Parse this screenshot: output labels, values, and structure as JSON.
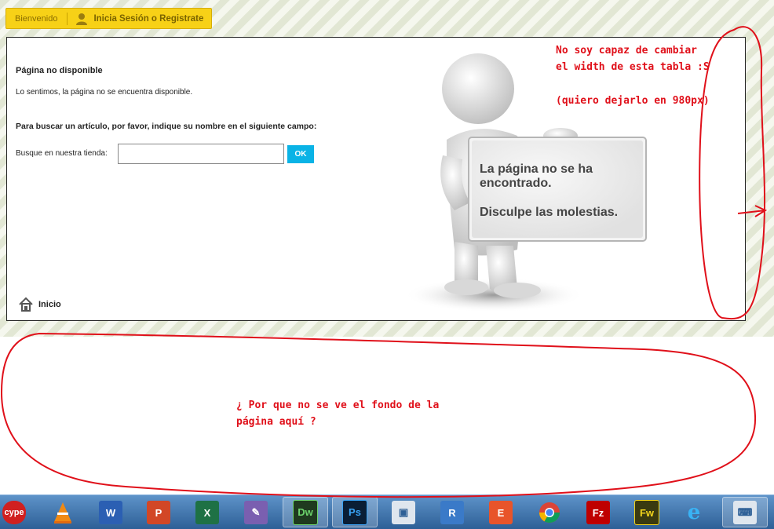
{
  "topbar": {
    "welcome": "Bienvenido",
    "login": "Inicia Sesión o Registrate"
  },
  "page": {
    "title": "Página no disponible",
    "message": "Lo sentimos, la página no se encuentra disponible.",
    "search_heading": "Para buscar un artículo, por favor, indique su nombre en el siguiente campo:",
    "search_label": "Busque en nuestra tienda:",
    "search_value": "",
    "ok_label": "OK",
    "home_label": "Inicio"
  },
  "sign": {
    "line1a": "La página no se ha",
    "line1b": "encontrado.",
    "line2": "Disculpe las molestias."
  },
  "annotations": {
    "a1": "No soy capaz de cambiar",
    "a2": "el width de esta tabla :S",
    "a3": "(quiero dejarlo en 980px)",
    "b1": "¿ Por que no se ve el fondo de la",
    "b2": "página aquí ?"
  },
  "taskbar": {
    "items": [
      {
        "icon": "cype-icon",
        "label": "cype"
      },
      {
        "icon": "vlc-icon",
        "label": ""
      },
      {
        "icon": "word-icon",
        "label": "W"
      },
      {
        "icon": "powerpoint-icon",
        "label": "P"
      },
      {
        "icon": "excel-icon",
        "label": "X"
      },
      {
        "icon": "tool-icon",
        "label": ""
      },
      {
        "icon": "dreamweaver-icon",
        "label": "Dw"
      },
      {
        "icon": "photoshop-icon",
        "label": "Ps"
      },
      {
        "icon": "monitor-icon",
        "label": ""
      },
      {
        "icon": "app-r-icon",
        "label": "R"
      },
      {
        "icon": "app-e-icon",
        "label": "E"
      },
      {
        "icon": "chrome-icon",
        "label": ""
      },
      {
        "icon": "filezilla-icon",
        "label": "Fz"
      },
      {
        "icon": "fireworks-icon",
        "label": "Fw"
      },
      {
        "icon": "ie-icon",
        "label": "e"
      },
      {
        "icon": "remote-desktop-icon",
        "label": ""
      }
    ]
  },
  "colors": {
    "accent": "#f7d117",
    "ok": "#0ab3e6",
    "annotation": "#e0101a"
  }
}
